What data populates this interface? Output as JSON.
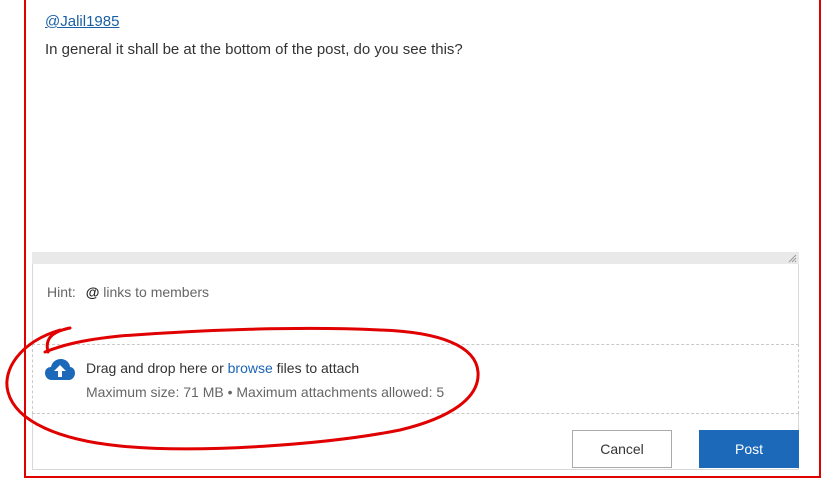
{
  "editor": {
    "mention": "@Jalil1985",
    "message": "In general it shall be at the bottom of the post, do you see this?"
  },
  "hint": {
    "label": "Hint:",
    "symbol": "@",
    "text": "links to members"
  },
  "dropzone": {
    "line1_before": "Drag and drop here or ",
    "browse": "browse",
    "line1_after": " files to attach",
    "line2": "Maximum size: 71 MB • Maximum attachments allowed: 5",
    "icon": "cloud-upload-icon"
  },
  "buttons": {
    "cancel": "Cancel",
    "post": "Post"
  },
  "colors": {
    "link": "#1a5fa6",
    "primary": "#1c69b9",
    "annotation": "#e00000"
  }
}
